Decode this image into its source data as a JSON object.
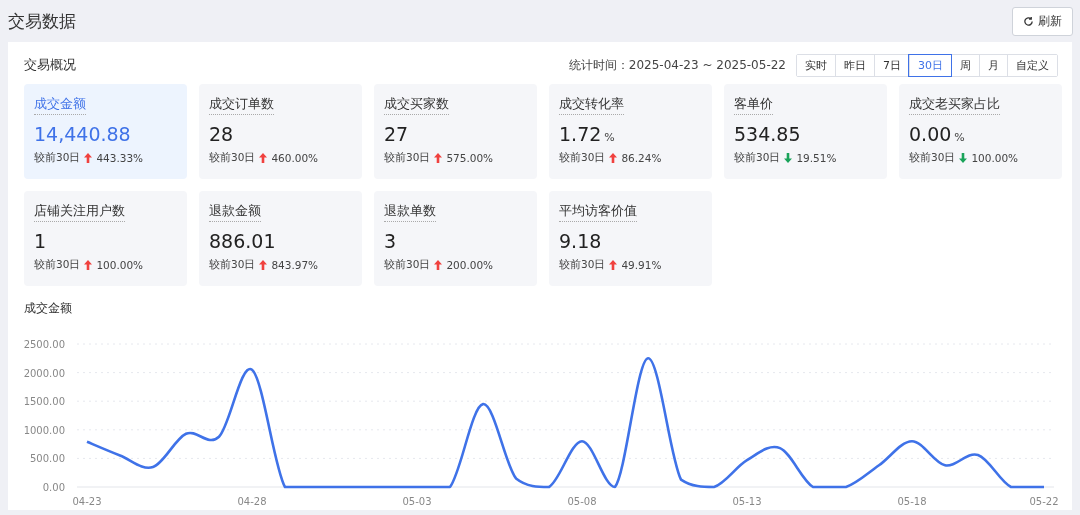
{
  "page_title": "交易数据",
  "refresh_button": {
    "label": "刷新"
  },
  "overview": {
    "title": "交易概况",
    "period_label": "统计时间：",
    "period_value": "2025-04-23 ~ 2025-05-22",
    "ranges": [
      {
        "label": "实时",
        "selected": false
      },
      {
        "label": "昨日",
        "selected": false
      },
      {
        "label": "7日",
        "selected": false
      },
      {
        "label": "30日",
        "selected": true
      },
      {
        "label": "周",
        "selected": false
      },
      {
        "label": "月",
        "selected": false
      },
      {
        "label": "自定义",
        "selected": false
      }
    ],
    "metrics": [
      {
        "label": "成交金额",
        "value": "14,440.88",
        "compare": "较前30日",
        "kind": "up",
        "change": "443.33%",
        "selected": true
      },
      {
        "label": "成交订单数",
        "value": "28",
        "compare": "较前30日",
        "kind": "up",
        "change": "460.00%",
        "selected": false
      },
      {
        "label": "成交买家数",
        "value": "27",
        "compare": "较前30日",
        "kind": "up",
        "change": "575.00%",
        "selected": false
      },
      {
        "label": "成交转化率",
        "value": "1.72",
        "unit": "%",
        "compare": "较前30日",
        "kind": "up",
        "change": "86.24%",
        "selected": false
      },
      {
        "label": "客单价",
        "value": "534.85",
        "compare": "较前30日",
        "kind": "down",
        "change": "19.51%",
        "selected": false
      },
      {
        "label": "成交老买家占比",
        "value": "0.00",
        "unit": "%",
        "compare": "较前30日",
        "kind": "down",
        "change": "100.00%",
        "selected": false
      },
      {
        "label": "店铺关注用户数",
        "value": "1",
        "compare": "较前30日",
        "kind": "up",
        "change": "100.00%",
        "selected": false
      },
      {
        "label": "退款金额",
        "value": "886.01",
        "compare": "较前30日",
        "kind": "up",
        "change": "843.97%",
        "selected": false
      },
      {
        "label": "退款单数",
        "value": "3",
        "compare": "较前30日",
        "kind": "up",
        "change": "200.00%",
        "selected": false
      },
      {
        "label": "平均访客价值",
        "value": "9.18",
        "compare": "较前30日",
        "kind": "up",
        "change": "49.91%",
        "selected": false
      }
    ]
  },
  "chart": {
    "chart_data": {
      "type": "line",
      "title": "成交金额",
      "categories": [
        "04-23",
        null,
        null,
        null,
        null,
        "04-28",
        null,
        null,
        null,
        null,
        "05-03",
        null,
        null,
        null,
        null,
        "05-08",
        null,
        null,
        null,
        null,
        "05-13",
        null,
        null,
        null,
        null,
        "05-18",
        null,
        null,
        null,
        "05-22"
      ],
      "series": [
        {
          "color": "#3f72e8",
          "values": [
            790,
            550,
            350,
            930,
            880,
            2050,
            0,
            0,
            0,
            0,
            0,
            0,
            1450,
            150,
            0,
            800,
            0,
            2250,
            130,
            0,
            470,
            680,
            0,
            0,
            380,
            800,
            380,
            560,
            0,
            0
          ]
        }
      ],
      "ylim": [
        0,
        2500
      ],
      "grid": true,
      "yticks": [
        {
          "value": 0,
          "label": "0.00"
        },
        {
          "value": 500,
          "label": "500.00"
        },
        {
          "value": 1000,
          "label": "1000.00"
        },
        {
          "value": 1500,
          "label": "1500.00"
        },
        {
          "value": 2000,
          "label": "2000.00"
        },
        {
          "value": 2500,
          "label": "2500.00"
        }
      ]
    }
  }
}
